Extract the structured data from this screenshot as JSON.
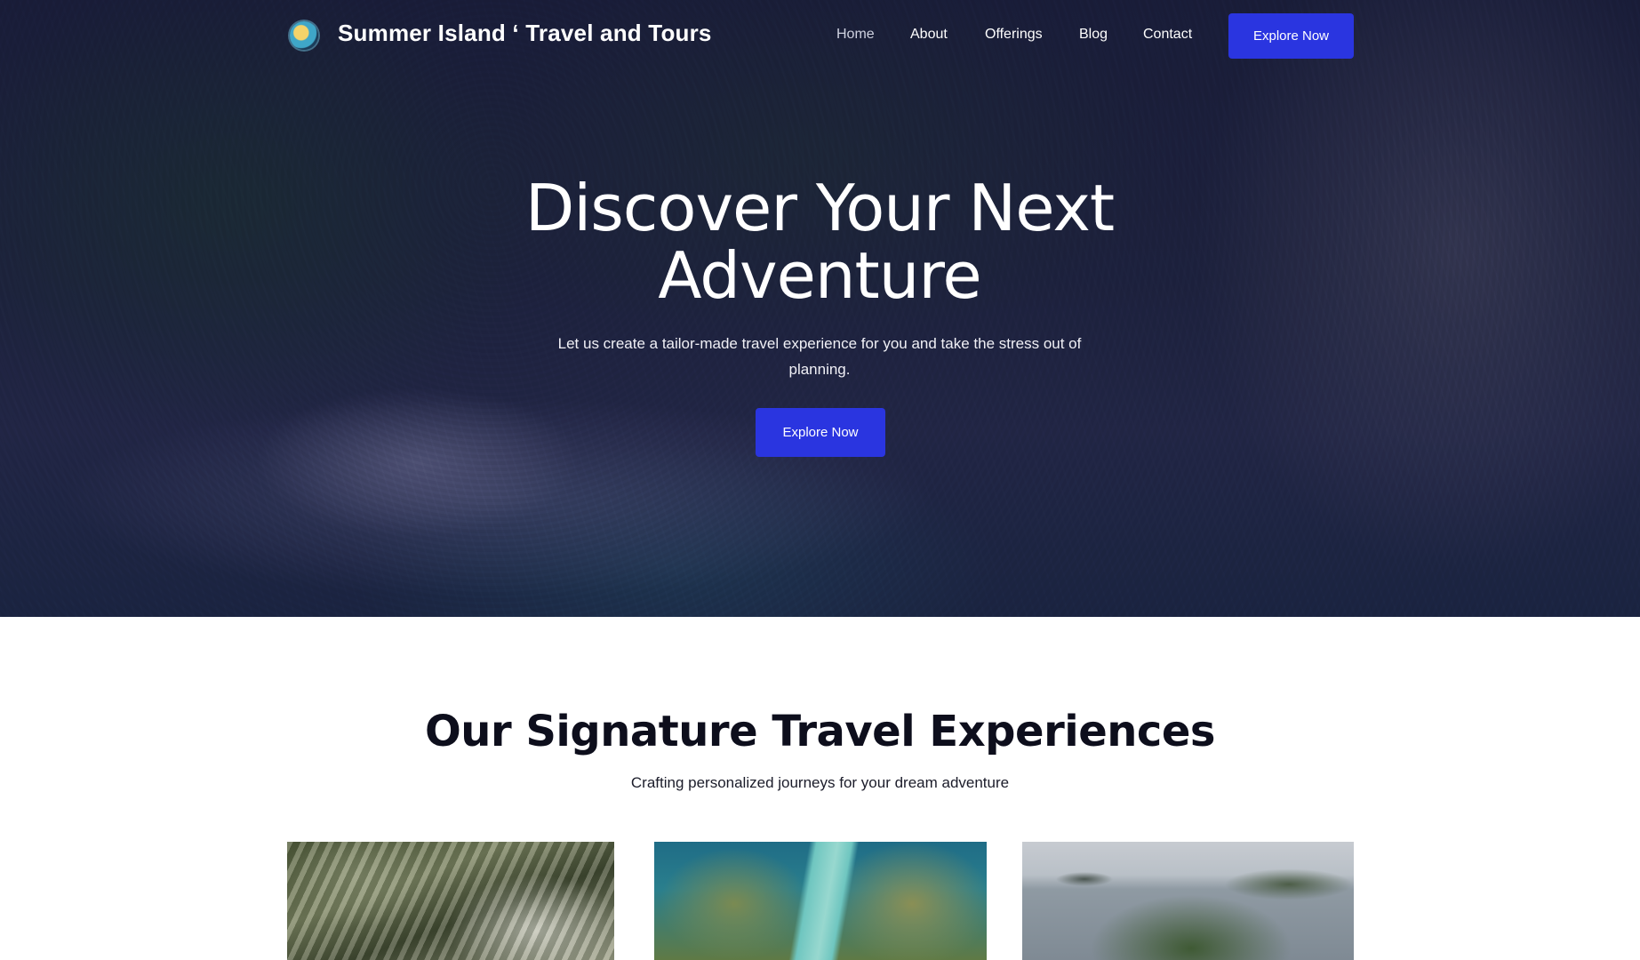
{
  "header": {
    "brand": "Summer Island ‘ Travel and Tours",
    "logo_icon": "globe-icon",
    "nav": [
      {
        "label": "Home",
        "active": true
      },
      {
        "label": "About"
      },
      {
        "label": "Offerings"
      },
      {
        "label": "Blog"
      },
      {
        "label": "Contact"
      }
    ],
    "cta_label": "Explore Now"
  },
  "hero": {
    "title_line1": "Discover Your Next",
    "title_line2": "Adventure",
    "subtitle": "Let us create a tailor-made travel experience for you and take the stress out of planning.",
    "cta_label": "Explore Now"
  },
  "section": {
    "title": "Our Signature Travel Experiences",
    "subtitle": "Crafting personalized journeys for your dream adventure"
  },
  "colors": {
    "accent": "#2a35e0",
    "hero_overlay": "#1d2138",
    "text_dark": "#0d0e1c"
  }
}
